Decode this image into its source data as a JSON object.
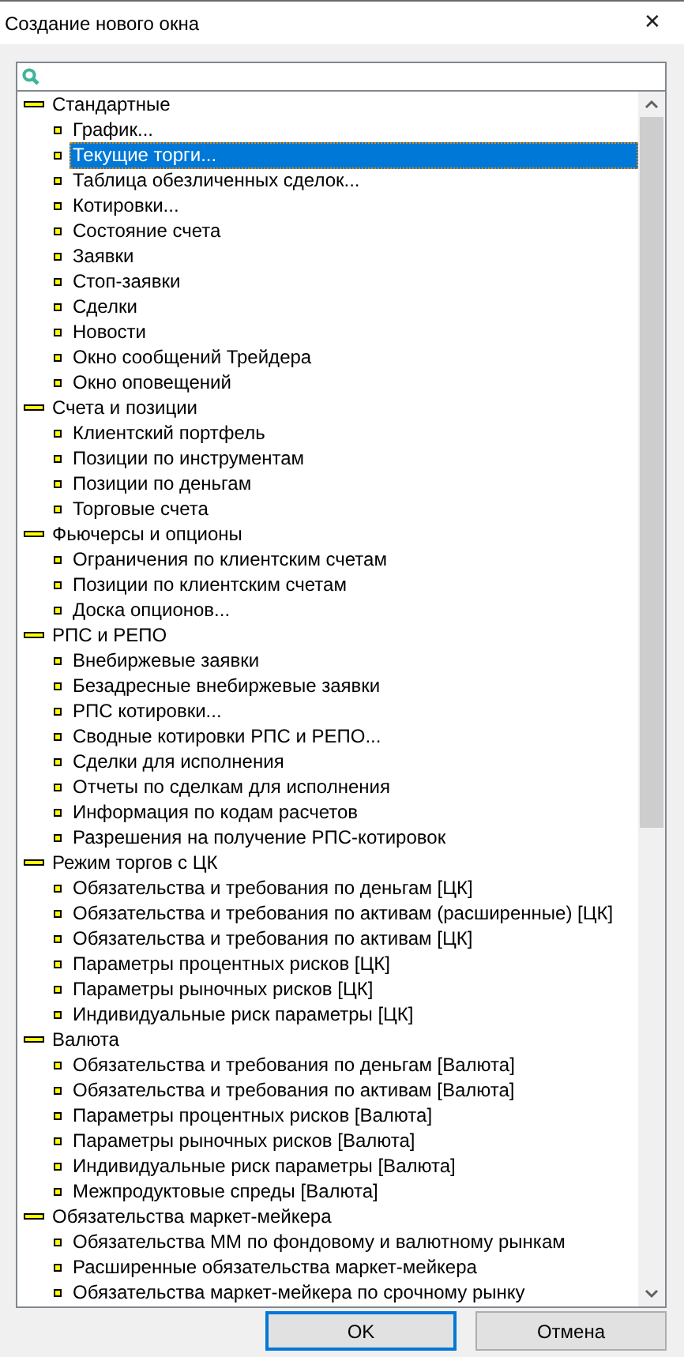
{
  "window": {
    "title": "Создание нового окна",
    "close": "✕"
  },
  "tree": [
    {
      "label": "Стандартные",
      "expanded": true,
      "selected": false,
      "children": [
        {
          "label": "График...",
          "selected": false
        },
        {
          "label": "Текущие торги...",
          "selected": true
        },
        {
          "label": "Таблица обезличенных сделок...",
          "selected": false
        },
        {
          "label": "Котировки...",
          "selected": false
        },
        {
          "label": "Состояние счета",
          "selected": false
        },
        {
          "label": "Заявки",
          "selected": false
        },
        {
          "label": "Стоп-заявки",
          "selected": false
        },
        {
          "label": "Сделки",
          "selected": false
        },
        {
          "label": "Новости",
          "selected": false
        },
        {
          "label": "Окно сообщений Трейдера",
          "selected": false
        },
        {
          "label": "Окно оповещений",
          "selected": false
        }
      ]
    },
    {
      "label": "Счета и позиции",
      "expanded": true,
      "selected": false,
      "children": [
        {
          "label": "Клиентский портфель",
          "selected": false
        },
        {
          "label": "Позиции по инструментам",
          "selected": false
        },
        {
          "label": "Позиции по деньгам",
          "selected": false
        },
        {
          "label": "Торговые счета",
          "selected": false
        }
      ]
    },
    {
      "label": "Фьючерсы и опционы",
      "expanded": true,
      "selected": false,
      "children": [
        {
          "label": "Ограничения по клиентским счетам",
          "selected": false
        },
        {
          "label": "Позиции по клиентским счетам",
          "selected": false
        },
        {
          "label": "Доска опционов...",
          "selected": false
        }
      ]
    },
    {
      "label": "РПС и РЕПО",
      "expanded": true,
      "selected": false,
      "children": [
        {
          "label": "Внебиржевые заявки",
          "selected": false
        },
        {
          "label": "Безадресные внебиржевые заявки",
          "selected": false
        },
        {
          "label": "РПС котировки...",
          "selected": false
        },
        {
          "label": "Сводные котировки РПС и РЕПО...",
          "selected": false
        },
        {
          "label": "Сделки для исполнения",
          "selected": false
        },
        {
          "label": "Отчеты по сделкам для исполнения",
          "selected": false
        },
        {
          "label": "Информация по кодам расчетов",
          "selected": false
        },
        {
          "label": "Разрешения на получение РПС-котировок",
          "selected": false
        }
      ]
    },
    {
      "label": "Режим торгов с ЦК",
      "expanded": true,
      "selected": false,
      "children": [
        {
          "label": "Обязательства и требования по деньгам [ЦК]",
          "selected": false
        },
        {
          "label": "Обязательства и требования по активам (расширенные) [ЦК]",
          "selected": false
        },
        {
          "label": "Обязательства и требования по активам [ЦК]",
          "selected": false
        },
        {
          "label": "Параметры процентных рисков [ЦК]",
          "selected": false
        },
        {
          "label": "Параметры рыночных рисков [ЦК]",
          "selected": false
        },
        {
          "label": "Индивидуальные риск параметры [ЦК]",
          "selected": false
        }
      ]
    },
    {
      "label": "Валюта",
      "expanded": true,
      "selected": false,
      "children": [
        {
          "label": "Обязательства и требования по деньгам [Валюта]",
          "selected": false
        },
        {
          "label": "Обязательства и требования по активам [Валюта]",
          "selected": false
        },
        {
          "label": "Параметры процентных рисков [Валюта]",
          "selected": false
        },
        {
          "label": "Параметры рыночных рисков [Валюта]",
          "selected": false
        },
        {
          "label": "Индивидуальные риск параметры [Валюта]",
          "selected": false
        },
        {
          "label": "Межпродуктовые спреды [Валюта]",
          "selected": false
        }
      ]
    },
    {
      "label": "Обязательства маркет-мейкера",
      "expanded": true,
      "selected": false,
      "children": [
        {
          "label": "Обязательства ММ по фондовому и валютному рынкам",
          "selected": false
        },
        {
          "label": "Расширенные обязательства маркет-мейкера",
          "selected": false
        },
        {
          "label": "Обязательства маркет-мейкера по срочному рынку",
          "selected": false
        }
      ]
    }
  ],
  "buttons": [
    {
      "label": "OK",
      "default": true
    },
    {
      "label": "Отмена",
      "default": false
    }
  ]
}
